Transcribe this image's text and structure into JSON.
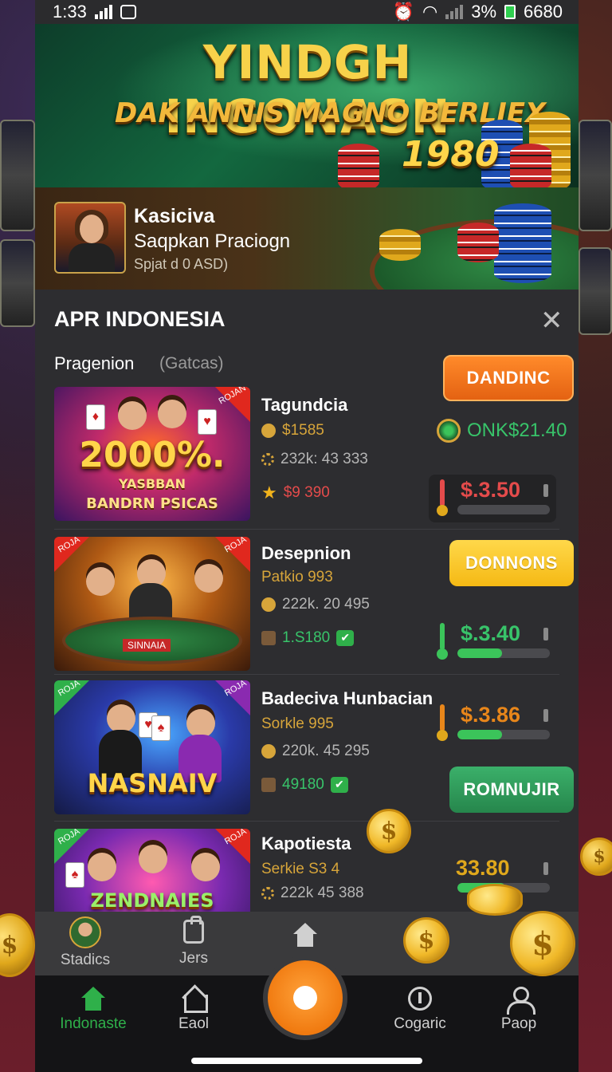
{
  "status_bar": {
    "time": "1:33",
    "battery_pct": "3%",
    "right_text": "6680"
  },
  "hero": {
    "title": "YINDGH INGONASN",
    "subtitle": "DAK ANNIS MAGNO BERLIEX",
    "amount": "1980"
  },
  "promo": {
    "title": "Kasiciva",
    "subtitle": "Saqpkan Praciogn",
    "note": "Spjat d 0 ASD)"
  },
  "panel": {
    "title": "APR INDONESIA",
    "tab_active": "Pragenion",
    "tab_inactive": "(Gatcas)",
    "close_icon": "close-icon"
  },
  "games": [
    {
      "thumb_big": "2000%.",
      "thumb_mid": "YASBBAN",
      "thumb_small": "BANDRN PSICAS",
      "corner": "ROJAN",
      "title": "Tagundcia",
      "line1": "$1585",
      "line2": "232k: 43 333",
      "line3": "$9 390",
      "button": "DANDINC",
      "status": "ONK$21.40",
      "meter_value": "$.3.50",
      "meter_fill_pct": 0,
      "meter_color": "#e44b4b"
    },
    {
      "thumb_sign": "SINNAIA",
      "corner_left": "ROJA",
      "corner_right": "ROJA",
      "title": "Desepnion",
      "line1": "Patkio 993",
      "line2": "222k. 20 495",
      "line3": "1.S180",
      "button": "DONNONS",
      "meter_value": "$.3.40",
      "meter_fill_pct": 48,
      "meter_color": "#3bc45a"
    },
    {
      "thumb_big": "NASNAIV",
      "corner_left": "ROJA",
      "corner_right": "ROJA",
      "title": "Badeciva Hunbacian",
      "line1": "Sorkle 995",
      "line2": "220k. 45 295",
      "line3": "49180",
      "button": "ROMNUJIR",
      "meter_value": "$.3.86",
      "meter_fill_pct": 48,
      "meter_color": "#e8861a"
    },
    {
      "thumb_big": "ZENDNAIES",
      "corner_left": "ROJA",
      "corner_right": "ROJA",
      "title": "Kapotiesta",
      "line1": "Serkie S3 4",
      "line2": "222k 45 388",
      "meter_value": "33.80",
      "meter_fill_pct": 52,
      "meter_color": "#3bc45a"
    }
  ],
  "nav": {
    "top_items": [
      "Stadics",
      "Jers"
    ],
    "bottom_items": [
      "Indonaste",
      "Eaol",
      "Cogaric",
      "Paop"
    ]
  },
  "colors": {
    "accent_orange": "#f07a10",
    "accent_green": "#38c46a",
    "accent_gold": "#d7a53a"
  }
}
